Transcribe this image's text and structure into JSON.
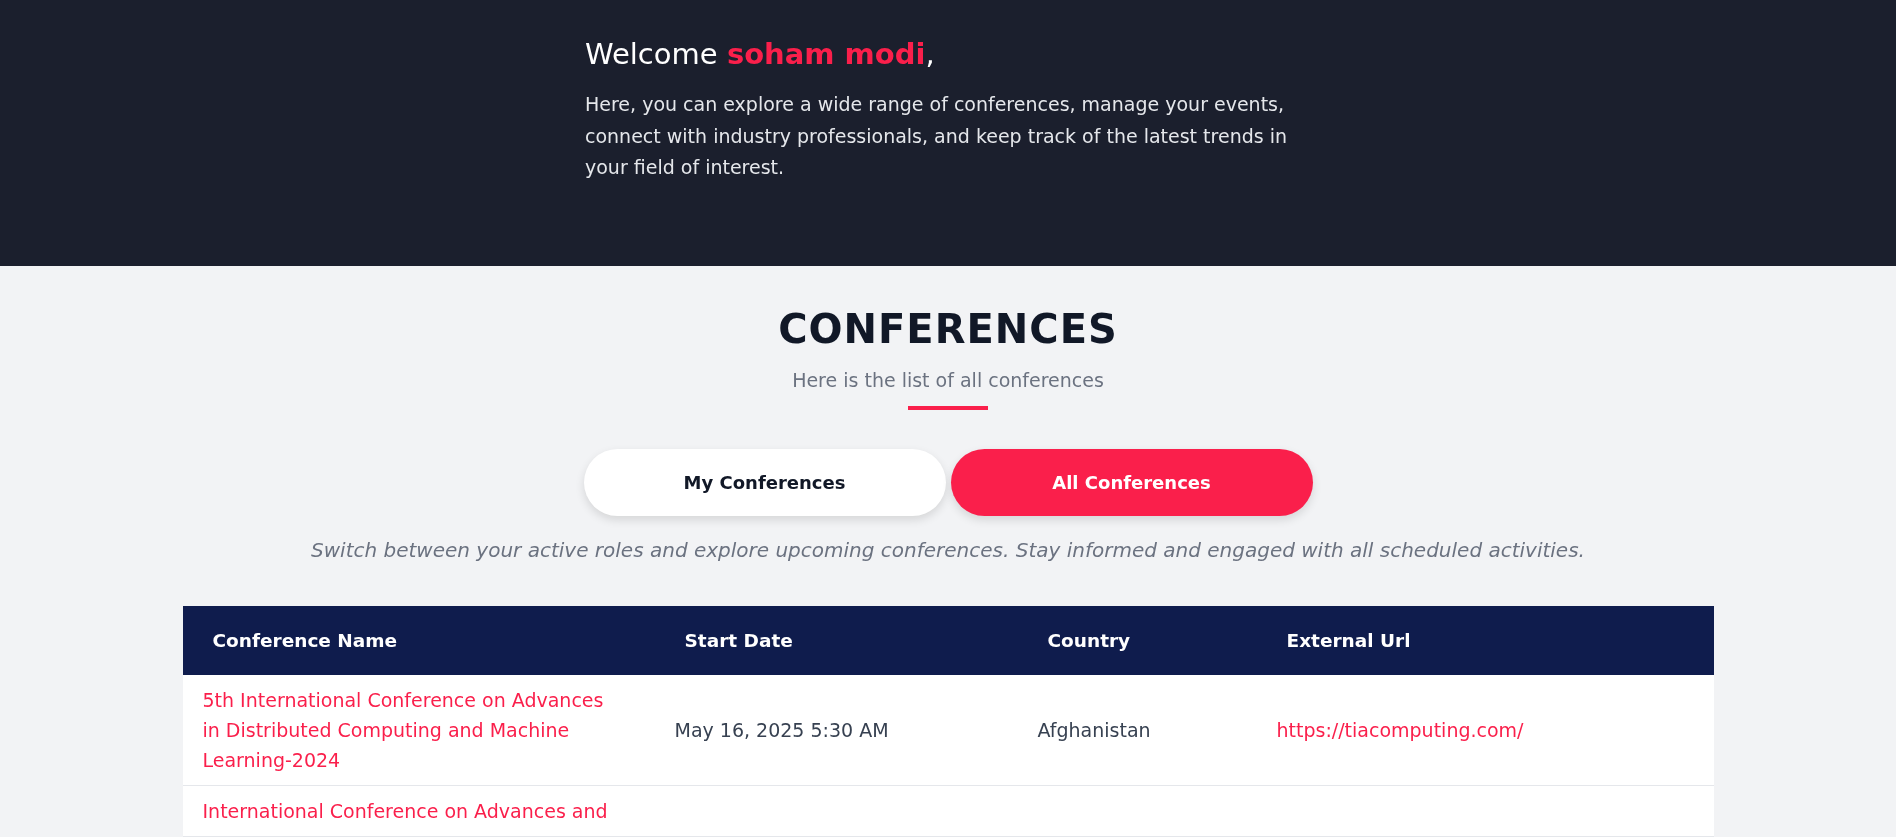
{
  "hero": {
    "greeting": "Welcome **soham modi**,",
    "intro": "Here, you can explore a wide range of conferences, manage your events, connect with industry professionals, and keep track of the latest trends in your field of interest."
  },
  "section": {
    "title": "CONFERENCES",
    "subtitle": "Here is the list of all conferences"
  },
  "tabs": [
    {
      "label": "My Conferences",
      "selected": false
    },
    {
      "label": "All Conferences",
      "selected": true
    }
  ],
  "tab_hint": "Switch between your active roles and explore upcoming conferences. Stay informed and engaged with all scheduled activities.",
  "table": {
    "columns": [
      {
        "label": "Conference Name",
        "kind": "link"
      },
      {
        "label": "Start Date",
        "kind": "text"
      },
      {
        "label": "Country",
        "kind": "text"
      },
      {
        "label": "External Url",
        "kind": "link"
      }
    ],
    "rows": [
      {
        "cells": [
          "5th International Conference on Advances in Distributed Computing and Machine Learning-2024",
          "May 16, 2025 5:30 AM",
          "Afghanistan",
          "https://tiacomputing.com/"
        ]
      },
      {
        "cells": [
          "International Conference on Advances and"
        ]
      }
    ]
  }
}
